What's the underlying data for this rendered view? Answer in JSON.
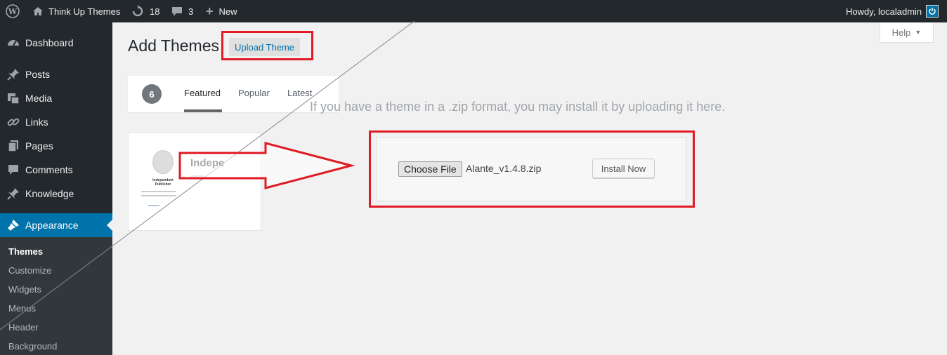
{
  "admin_bar": {
    "site_name": "Think Up Themes",
    "updates_count": "18",
    "comments_count": "3",
    "new_label": "New",
    "greeting": "Howdy, localadmin"
  },
  "sidebar": {
    "items": [
      {
        "label": "Dashboard",
        "icon": "dashboard-icon"
      },
      {
        "label": "Posts",
        "icon": "pin-icon"
      },
      {
        "label": "Media",
        "icon": "media-icon"
      },
      {
        "label": "Links",
        "icon": "link-icon"
      },
      {
        "label": "Pages",
        "icon": "pages-icon"
      },
      {
        "label": "Comments",
        "icon": "comment-icon"
      },
      {
        "label": "Knowledge",
        "icon": "pin-icon"
      },
      {
        "label": "Appearance",
        "icon": "brush-icon"
      }
    ],
    "submenu": [
      "Themes",
      "Customize",
      "Widgets",
      "Menus",
      "Header",
      "Background"
    ]
  },
  "main": {
    "title": "Add Themes",
    "upload_button": "Upload Theme",
    "help_label": "Help",
    "filter": {
      "count": "6",
      "tabs": [
        "Featured",
        "Popular",
        "Latest"
      ]
    },
    "upload_help_text": "If you have a theme in a .zip format, you may install it by uploading it here.",
    "choose_file_label": "Choose File",
    "file_name": "Alante_v1.4.8.zip",
    "install_label": "Install Now",
    "theme_card": {
      "name_fragment": "Indepe",
      "author_fragment": "Independent Publisher"
    }
  },
  "colors": {
    "highlight": "#e01b24",
    "admin_dark": "#23282d",
    "accent": "#0073aa"
  }
}
